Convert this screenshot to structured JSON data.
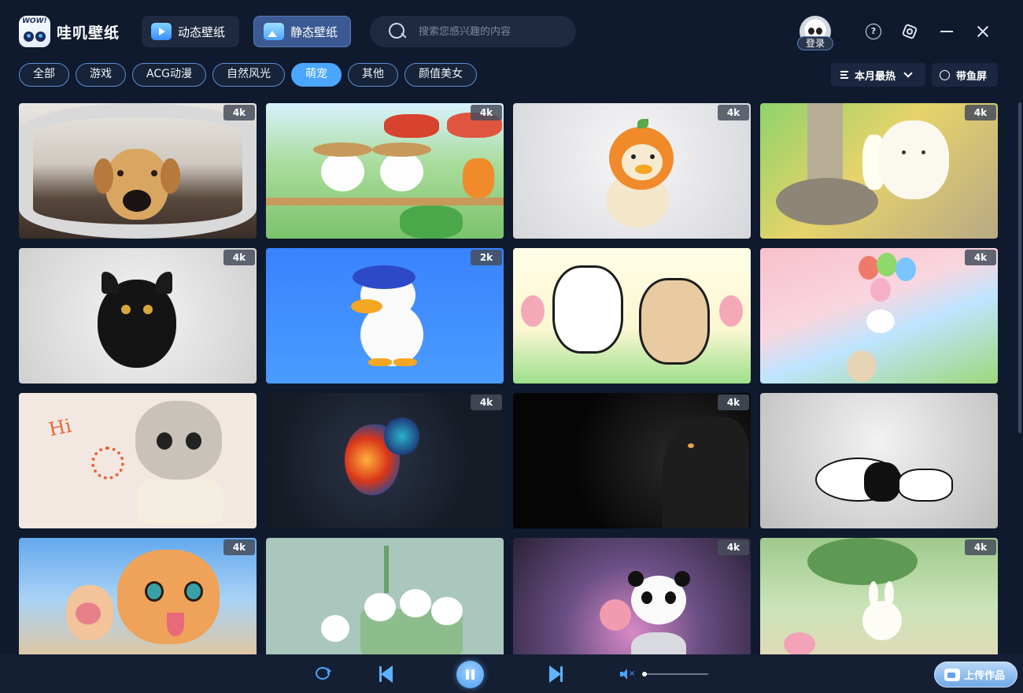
{
  "app": {
    "logo_badge_text": "WOW!",
    "name": "哇叽壁纸"
  },
  "modes": {
    "dynamic_label": "动态壁纸",
    "static_label": "静态壁纸",
    "active": "static"
  },
  "search": {
    "placeholder": "搜索您感兴趣的内容"
  },
  "user": {
    "login_label": "登录"
  },
  "window": {
    "help_glyph": "?"
  },
  "categories": {
    "items": [
      "全部",
      "游戏",
      "ACG动漫",
      "自然风光",
      "萌宠",
      "其他",
      "颜值美女"
    ],
    "active": "萌宠"
  },
  "toolbar": {
    "sort_label": "本月最热",
    "fish_label": "带鱼屏"
  },
  "wallpapers": [
    {
      "subject": "dog-fisheye",
      "resolution": "4k"
    },
    {
      "subject": "garden-bunnies",
      "resolution": "4k"
    },
    {
      "subject": "orange-hat-duckling",
      "resolution": "4k"
    },
    {
      "subject": "garden-fountain",
      "resolution": "4k"
    },
    {
      "subject": "black-kitten",
      "resolution": "4k"
    },
    {
      "subject": "beret-duck",
      "resolution": "2k"
    },
    {
      "subject": "doodle-dogs",
      "resolution": ""
    },
    {
      "subject": "balloon-bunnies",
      "resolution": "4k"
    },
    {
      "subject": "hi-cat-toast",
      "resolution": ""
    },
    {
      "subject": "fire-rooster",
      "resolution": "4k"
    },
    {
      "subject": "dark-cat",
      "resolution": "4k"
    },
    {
      "subject": "snoopy",
      "resolution": ""
    },
    {
      "subject": "orange-cat-paws",
      "resolution": "4k"
    },
    {
      "subject": "bamboo-pandas",
      "resolution": ""
    },
    {
      "subject": "panda-scooter",
      "resolution": "4k"
    },
    {
      "subject": "bunny-lotus",
      "resolution": "4k"
    }
  ],
  "art_text": {
    "hi": "Hi"
  },
  "player": {
    "state": "playing",
    "muted": true,
    "volume": 0.0
  },
  "upload": {
    "label": "上传作品"
  },
  "colors": {
    "background": "#0f1a2e",
    "accent": "#4aa6ff",
    "active_mode": "#3b5a93"
  }
}
